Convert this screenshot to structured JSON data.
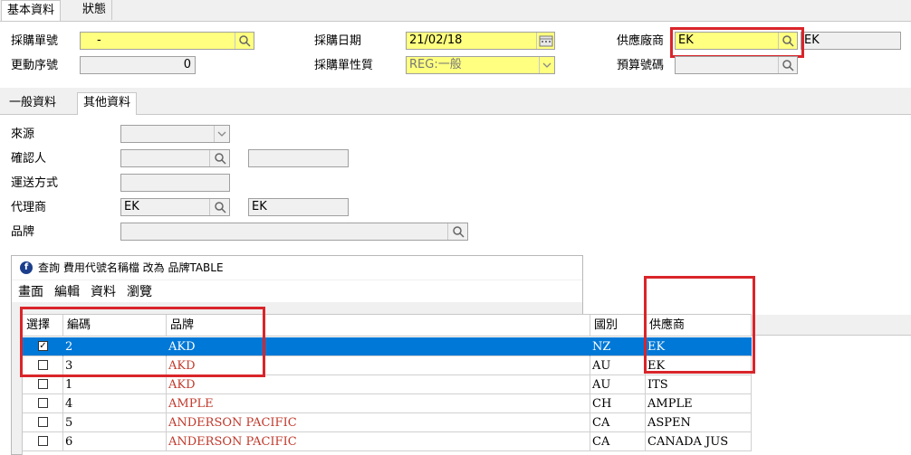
{
  "top_tabs": [
    "基本資料",
    "狀態"
  ],
  "header": {
    "po_no_label": "採購單號",
    "po_no_value": "-",
    "rev_label": "更動序號",
    "rev_value": "0",
    "date_label": "採購日期",
    "date_value": "21/02/18",
    "type_label": "採購單性質",
    "type_value": "REG:一般",
    "vendor_label": "供應廠商",
    "vendor_code": "EK",
    "vendor_name": "EK",
    "budget_label": "預算號碼"
  },
  "sub_tabs": [
    "一般資料",
    "其他資料"
  ],
  "other": {
    "source_label": "來源",
    "confirm_label": "確認人",
    "ship_label": "運送方式",
    "agent_label": "代理商",
    "agent_code": "EK",
    "agent_name": "EK",
    "brand_label": "品牌"
  },
  "dialog": {
    "title": "查詢 費用代號名稱檔 改為 品牌TABLE",
    "menu": [
      "畫面",
      "編輯",
      "資料",
      "瀏覽"
    ],
    "columns": [
      "選擇",
      "編碼",
      "品牌",
      "國別",
      "供應商"
    ],
    "rows": [
      {
        "checked": true,
        "code": "2",
        "brand": "AKD",
        "country": "NZ",
        "supplier": "EK"
      },
      {
        "checked": false,
        "code": "3",
        "brand": "AKD",
        "country": "AU",
        "supplier": "EK"
      },
      {
        "checked": false,
        "code": "1",
        "brand": "AKD",
        "country": "AU",
        "supplier": "ITS"
      },
      {
        "checked": false,
        "code": "4",
        "brand": "AMPLE",
        "country": "CH",
        "supplier": "AMPLE"
      },
      {
        "checked": false,
        "code": "5",
        "brand": "ANDERSON PACIFIC",
        "country": "CA",
        "supplier": "ASPEN"
      },
      {
        "checked": false,
        "code": "6",
        "brand": "ANDERSON PACIFIC",
        "country": "CA",
        "supplier": "CANADA JUS"
      }
    ],
    "selected_index": 0
  },
  "colors": {
    "selection": "#0078d7",
    "brand_text": "#c0392b",
    "highlight_box": "#d9252a",
    "required_field": "#ffff80"
  }
}
